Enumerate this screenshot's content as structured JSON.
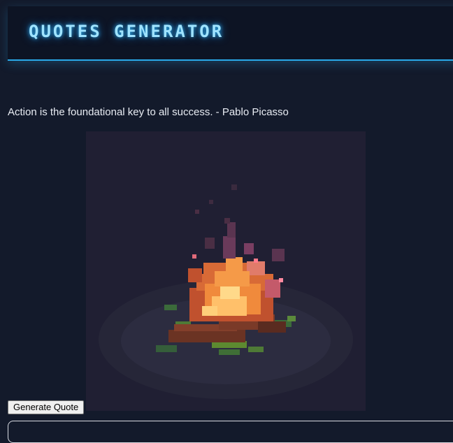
{
  "header": {
    "title": "QUOTES GENERATOR"
  },
  "quote": {
    "text": "Action is the foundational key to all success. - Pablo Picasso"
  },
  "image": {
    "subject": "pixel-art-campfire"
  },
  "controls": {
    "generate_label": "Generate Quote"
  },
  "colors": {
    "background": "#131a2b",
    "header_bg": "#0d1424",
    "accent": "#2aa9e8",
    "title_glow": "#9fe3ff"
  }
}
